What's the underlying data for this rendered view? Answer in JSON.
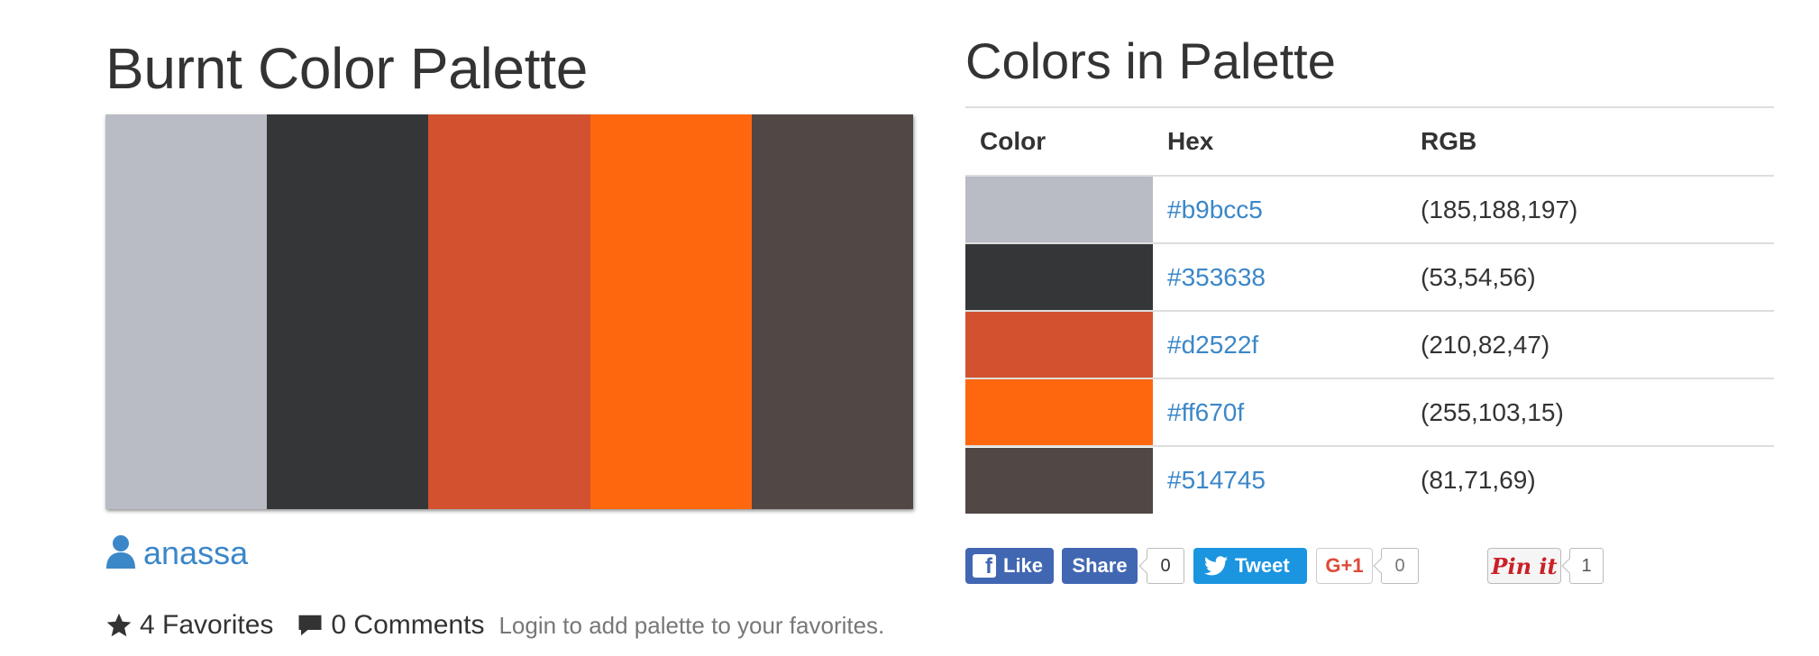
{
  "title": "Burnt Color Palette",
  "palette": {
    "swatches": [
      "#b9bcc5",
      "#353638",
      "#d2522f",
      "#ff670f",
      "#514745"
    ]
  },
  "author": {
    "icon": "user-icon",
    "name": "anassa"
  },
  "meta": {
    "favorites": {
      "icon": "star-icon",
      "text": "4 Favorites"
    },
    "comments": {
      "icon": "comment-icon",
      "text": "0 Comments"
    },
    "login_text": "Login to add palette to your favorites."
  },
  "colors_section": {
    "heading": "Colors in Palette",
    "columns": [
      "Color",
      "Hex",
      "RGB"
    ],
    "rows": [
      {
        "color": "#b9bcc5",
        "hex": "#b9bcc5",
        "rgb": "(185,188,197)"
      },
      {
        "color": "#353638",
        "hex": "#353638",
        "rgb": "(53,54,56)"
      },
      {
        "color": "#d2522f",
        "hex": "#d2522f",
        "rgb": "(210,82,47)"
      },
      {
        "color": "#ff670f",
        "hex": "#ff670f",
        "rgb": "(255,103,15)"
      },
      {
        "color": "#514745",
        "hex": "#514745",
        "rgb": "(81,71,69)"
      }
    ]
  },
  "social": {
    "fb_like": "Like",
    "fb_share": "Share",
    "fb_count": "0",
    "tweet": "Tweet",
    "gplus": "G+1",
    "gplus_count": "0",
    "pin": "Pin it",
    "pin_count": "1"
  },
  "colors": {
    "link": "#3b87c8",
    "facebook": "#4267b2",
    "twitter": "#1b95e0",
    "pinterest": "#cb2027",
    "gplus": "#dd4b39"
  }
}
